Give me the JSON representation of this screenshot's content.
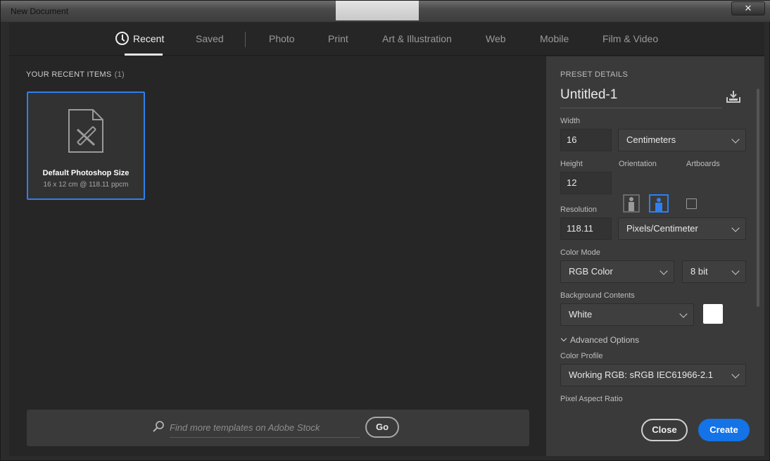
{
  "window": {
    "title": "New Document",
    "close_glyph": "✕"
  },
  "tabs": [
    {
      "label": "Recent",
      "active": true,
      "icon": "clock-icon"
    },
    {
      "label": "Saved"
    },
    {
      "label": "Photo"
    },
    {
      "label": "Print"
    },
    {
      "label": "Art & Illustration"
    },
    {
      "label": "Web"
    },
    {
      "label": "Mobile"
    },
    {
      "label": "Film & Video"
    }
  ],
  "recent": {
    "heading": "YOUR RECENT ITEMS",
    "count": "(1)",
    "items": [
      {
        "title": "Default Photoshop Size",
        "subtitle": "16 x 12 cm @ 118.11 ppcm",
        "icon": "document-pencil-icon"
      }
    ]
  },
  "search": {
    "placeholder": "Find more templates on Adobe Stock",
    "value": "",
    "go_label": "Go"
  },
  "preset": {
    "heading": "PRESET DETAILS",
    "name": "Untitled-1",
    "width_label": "Width",
    "width_value": "16",
    "width_unit": "Centimeters",
    "height_label": "Height",
    "height_value": "12",
    "orientation_label": "Orientation",
    "artboards_label": "Artboards",
    "artboards_checked": false,
    "resolution_label": "Resolution",
    "resolution_value": "118.11",
    "resolution_unit": "Pixels/Centimeter",
    "color_mode_label": "Color Mode",
    "color_mode": "RGB Color",
    "bit_depth": "8 bit",
    "background_label": "Background Contents",
    "background": "White",
    "background_color": "#ffffff",
    "advanced_label": "Advanced Options",
    "color_profile_label": "Color Profile",
    "color_profile": "Working RGB: sRGB IEC61966-2.1",
    "pixel_aspect_label": "Pixel Aspect Ratio"
  },
  "actions": {
    "close_label": "Close",
    "create_label": "Create"
  },
  "colors": {
    "accent": "#1473e6",
    "selection": "#2f7ff0"
  }
}
